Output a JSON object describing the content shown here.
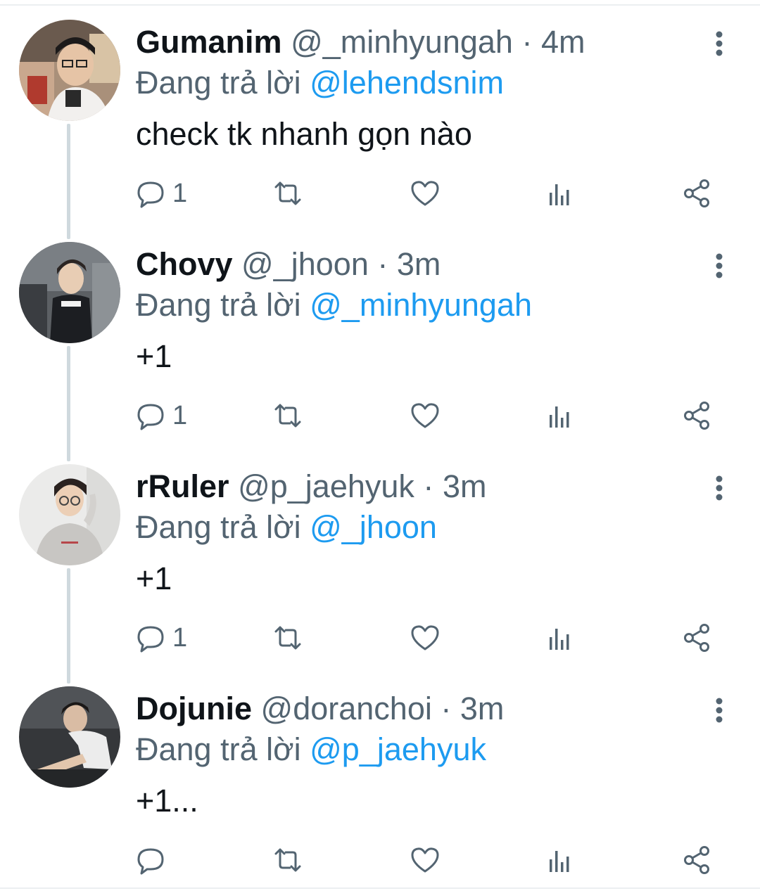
{
  "colors": {
    "text": "#0f1419",
    "muted": "#536471",
    "mention": "#1d9bf0",
    "thread_line": "#cfd9de"
  },
  "tweets": [
    {
      "name": "Gumanim",
      "handle": "@_minhyungah",
      "separator": "·",
      "time": "4m",
      "reply_prefix": "Đang trả lời",
      "reply_to": "@lehendsnim",
      "text": "check tk nhanh gọn nào",
      "reply_count": "1",
      "icons": [
        "reply-icon",
        "retweet-icon",
        "like-icon",
        "views-icon",
        "share-icon",
        "more-icon"
      ]
    },
    {
      "name": "Chovy",
      "handle": "@_jhoon",
      "separator": "·",
      "time": "3m",
      "reply_prefix": "Đang trả lời",
      "reply_to": "@_minhyungah",
      "text": "+1",
      "reply_count": "1",
      "icons": [
        "reply-icon",
        "retweet-icon",
        "like-icon",
        "views-icon",
        "share-icon",
        "more-icon"
      ]
    },
    {
      "name": "rRuler",
      "handle": "@p_jaehyuk",
      "separator": "·",
      "time": "3m",
      "reply_prefix": "Đang trả lời",
      "reply_to": "@_jhoon",
      "text": "+1",
      "reply_count": "1",
      "icons": [
        "reply-icon",
        "retweet-icon",
        "like-icon",
        "views-icon",
        "share-icon",
        "more-icon"
      ]
    },
    {
      "name": "Dojunie",
      "handle": "@doranchoi",
      "separator": "·",
      "time": "3m",
      "reply_prefix": "Đang trả lời",
      "reply_to": "@p_jaehyuk",
      "text": "+1...",
      "reply_count": "",
      "icons": [
        "reply-icon",
        "retweet-icon",
        "like-icon",
        "views-icon",
        "share-icon",
        "more-icon"
      ]
    }
  ]
}
